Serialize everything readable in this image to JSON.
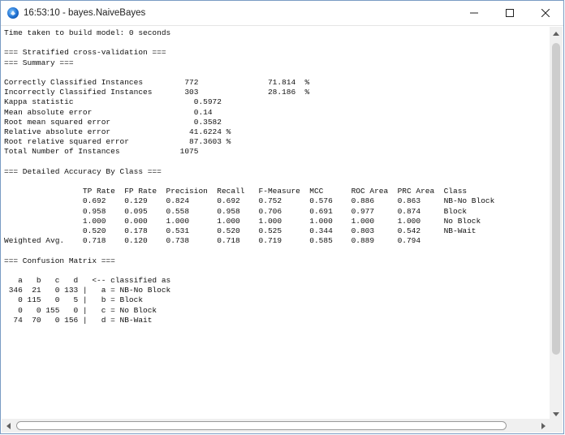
{
  "window": {
    "title": "16:53:10 - bayes.NaiveBayes",
    "minimize_glyph": "—",
    "maximize_glyph": "☐",
    "close_glyph": "✕"
  },
  "output": {
    "lines": [
      "Time taken to build model: 0 seconds",
      "",
      "=== Stratified cross-validation ===",
      "=== Summary ===",
      "",
      "Correctly Classified Instances         772               71.814  %",
      "Incorrectly Classified Instances       303               28.186  %",
      "Kappa statistic                          0.5972",
      "Mean absolute error                      0.14",
      "Root mean squared error                  0.3582",
      "Relative absolute error                 41.6224 %",
      "Root relative squared error             87.3603 %",
      "Total Number of Instances             1075",
      "",
      "=== Detailed Accuracy By Class ===",
      "",
      "                 TP Rate  FP Rate  Precision  Recall   F-Measure  MCC      ROC Area  PRC Area  Class",
      "                 0.692    0.129    0.824      0.692    0.752      0.576    0.886     0.863     NB-No Block",
      "                 0.958    0.095    0.558      0.958    0.706      0.691    0.977     0.874     Block",
      "                 1.000    0.000    1.000      1.000    1.000      1.000    1.000     1.000     No Block",
      "                 0.520    0.178    0.531      0.520    0.525      0.344    0.803     0.542     NB-Wait",
      "Weighted Avg.    0.718    0.120    0.738      0.718    0.719      0.585    0.889     0.794",
      "",
      "=== Confusion Matrix ===",
      "",
      "   a   b   c   d   <-- classified as",
      " 346  21   0 133 |   a = NB-No Block",
      "   0 115   0   5 |   b = Block",
      "   0   0 155   0 |   c = No Block",
      "  74  70   0 156 |   d = NB-Wait"
    ]
  }
}
